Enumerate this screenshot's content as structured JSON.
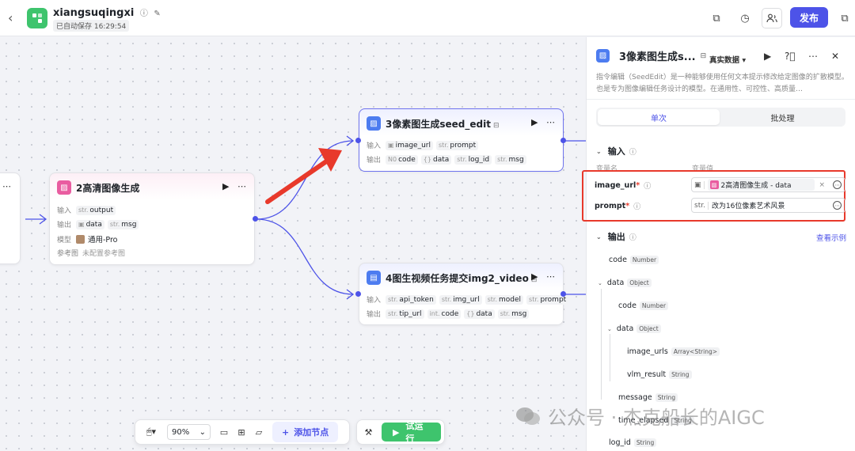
{
  "header": {
    "app_name": "xiangsuqingxi",
    "saved_text": "已自动保存 16:29:54",
    "publish_label": "发布"
  },
  "canvas": {
    "nodes": [
      {
        "id": "node2",
        "title": "2高清图像生成",
        "inputs_label": "输入",
        "outputs_label": "输出",
        "model_label": "模型",
        "ref_label": "参考图",
        "input_tags": [
          {
            "type": "str.",
            "name": "output"
          }
        ],
        "output_tags": [
          {
            "type": "img",
            "name": "data"
          },
          {
            "type": "str.",
            "name": "msg"
          }
        ],
        "model_value": "通用-Pro",
        "ref_value": "未配置参考图"
      },
      {
        "id": "node3",
        "title": "3像素图生成seed_edit",
        "inputs_label": "输入",
        "outputs_label": "输出",
        "input_tags": [
          {
            "type": "img",
            "name": "image_url"
          },
          {
            "type": "str.",
            "name": "prompt"
          }
        ],
        "output_tags": [
          {
            "type": "N0",
            "name": "code"
          },
          {
            "type": "{}",
            "name": "data"
          },
          {
            "type": "str.",
            "name": "log_id"
          },
          {
            "type": "str.",
            "name": "msg"
          }
        ]
      },
      {
        "id": "node4",
        "title": "4图生视频任务提交img2_video",
        "inputs_label": "输入",
        "outputs_label": "输出",
        "input_tags": [
          {
            "type": "str.",
            "name": "api_token"
          },
          {
            "type": "str.",
            "name": "img_url"
          },
          {
            "type": "str.",
            "name": "model"
          },
          {
            "type": "str.",
            "name": "prompt"
          }
        ],
        "output_tags": [
          {
            "type": "str.",
            "name": "tip_url"
          },
          {
            "type": "int.",
            "name": "code"
          },
          {
            "type": "{}",
            "name": "data"
          },
          {
            "type": "str.",
            "name": "msg"
          }
        ]
      }
    ],
    "arrow_color": "#e8392b",
    "edge_color": "#4d53e8"
  },
  "toolbar": {
    "zoom": "90%",
    "add_node_label": "添加节点",
    "run_label": "试运行"
  },
  "panel": {
    "title": "3像素图生成s...",
    "data_mode": "真实数据",
    "description": "指令编辑（SeedEdit）是一种能够使用任何文本提示修改给定图像的扩散模型。也是专为图像编辑任务设计的模型。在通用性、可控性、高质量…",
    "tabs": [
      "单次",
      "批处理"
    ],
    "input_section": "输入",
    "col_name": "变量名",
    "col_value": "变量值",
    "inputs": [
      {
        "name": "image_url",
        "type": "img",
        "value": "2高清图像生成 - data"
      },
      {
        "name": "prompt",
        "type": "str.",
        "value": "改为16位像素艺术风景"
      }
    ],
    "output_section": "输出",
    "view_example": "查看示例",
    "outputs": [
      {
        "name": "code",
        "type": "Number"
      },
      {
        "name": "data",
        "type": "Object"
      },
      {
        "name": "code",
        "type": "Number"
      },
      {
        "name": "data",
        "type": "Object"
      },
      {
        "name": "image_urls",
        "type": "Array<String>"
      },
      {
        "name": "vlm_result",
        "type": "String"
      },
      {
        "name": "message",
        "type": "String"
      },
      {
        "name": "time_elapsed",
        "type": "String"
      },
      {
        "name": "log_id",
        "type": "String"
      }
    ]
  },
  "watermark": "公众号 · 杰克船长的AIGC"
}
